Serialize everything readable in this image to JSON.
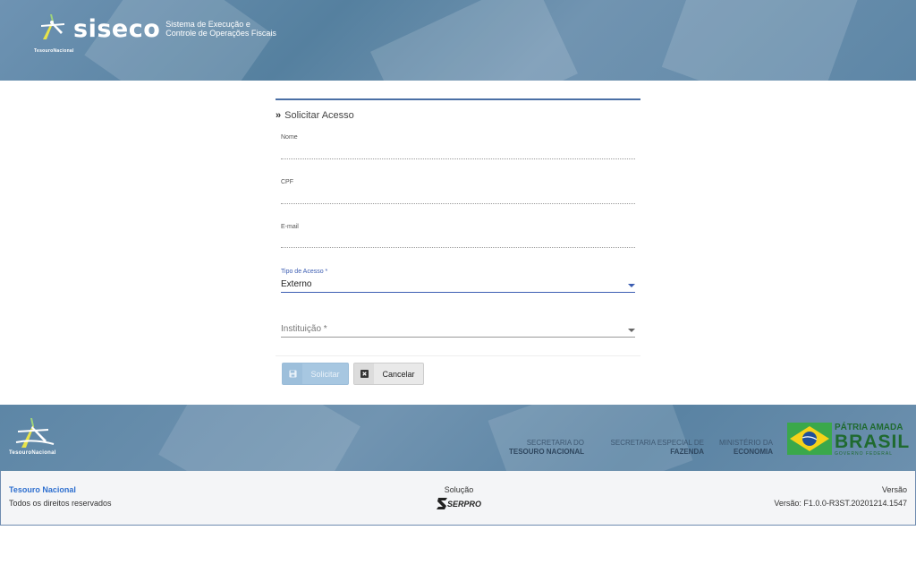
{
  "header": {
    "tn_label": "TesouroNacional",
    "app_name": "siseco",
    "app_subtitle_1": "Sistema de Execução e",
    "app_subtitle_2": "Controle de Operações Fiscais"
  },
  "form": {
    "title": "Solicitar Acesso",
    "fields": {
      "nome": {
        "label": "Nome",
        "value": ""
      },
      "cpf": {
        "label": "CPF",
        "value": ""
      },
      "email": {
        "label": "E-mail",
        "value": ""
      },
      "tipo_acesso": {
        "label": "Tipo de Acesso *",
        "value": "Externo"
      },
      "instituicao": {
        "placeholder": "Instituição *"
      }
    },
    "buttons": {
      "solicitar": "Solicitar",
      "cancelar": "Cancelar"
    }
  },
  "footer_band": {
    "tn_label": "TesouroNacional",
    "orgs": [
      {
        "line1": "SECRETARIA DO",
        "line2": "TESOURO NACIONAL"
      },
      {
        "line1": "SECRETARIA ESPECIAL DE",
        "line2": "FAZENDA"
      },
      {
        "line1": "MINISTÉRIO DA",
        "line2": "ECONOMIA"
      }
    ],
    "patria_1": "PÁTRIA AMADA",
    "patria_2": "BRASIL",
    "patria_3": "GOVERNO FEDERAL"
  },
  "bottom": {
    "org_name": "Tesouro Nacional",
    "rights": "Todos os direitos reservados",
    "solucao_label": "Solução",
    "serpro": "SERPRO",
    "versao_label": "Versão",
    "versao_value": "Versão: F1.0.0-R3ST.20201214.1547"
  },
  "colors": {
    "header_blue": "#6084a4",
    "accent": "#3c5db2",
    "link": "#2e6fcf",
    "button_primary": "#a7c7e1"
  }
}
